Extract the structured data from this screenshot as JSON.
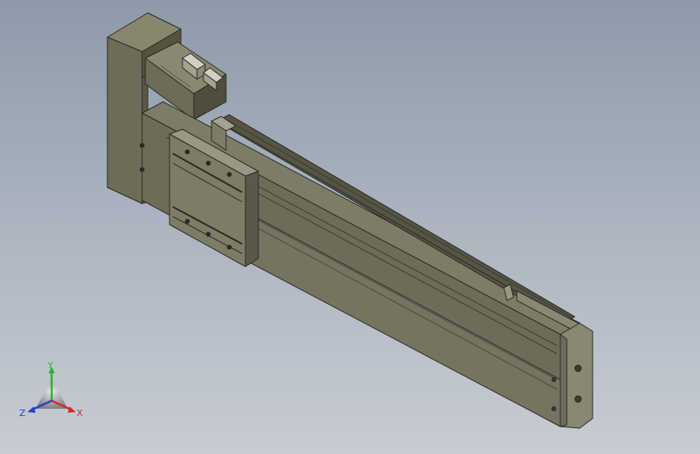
{
  "viewport": {
    "background_top": "#8e9aaa",
    "background_bottom": "#c8ccd3"
  },
  "model": {
    "body_color": "#6e6c58",
    "body_dark": "#4d4b3c",
    "body_light": "#88866e",
    "edge_color": "#2a2a22"
  },
  "triad": {
    "x_label": "X",
    "y_label": "Y",
    "z_label": "Z",
    "x_color": "#d42a2a",
    "y_color": "#28b428",
    "z_color": "#2a3ad4"
  }
}
